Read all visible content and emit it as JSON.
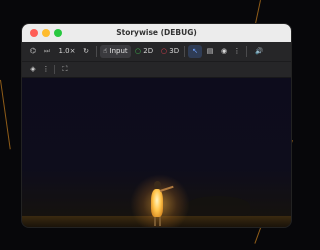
{
  "window": {
    "title": "Storywise (DEBUG)"
  },
  "toolbar": {
    "speed_label": "1.0×",
    "input_label": "Input",
    "mode_2d_label": "2D",
    "mode_3d_label": "3D"
  },
  "icons": {
    "game-remote-icon": "⌬",
    "step-frame-icon": "⏭",
    "reset-speed-icon": "↻",
    "input-pointer-icon": "☝",
    "select-arrow-icon": "↖",
    "list-icon": "▤",
    "visibility-icon": "◉",
    "more-icon": "⋮",
    "volume-icon": "🔊",
    "object-tool-icon": "◈",
    "fullscreen-icon": "⛶"
  },
  "colors": {
    "accent_2d": "#3fb950",
    "accent_3d": "#e0414f",
    "selected_tool": "#2f6fd6",
    "traffic_close": "#ff5f57",
    "traffic_min": "#febc2e",
    "traffic_max": "#28c840"
  }
}
